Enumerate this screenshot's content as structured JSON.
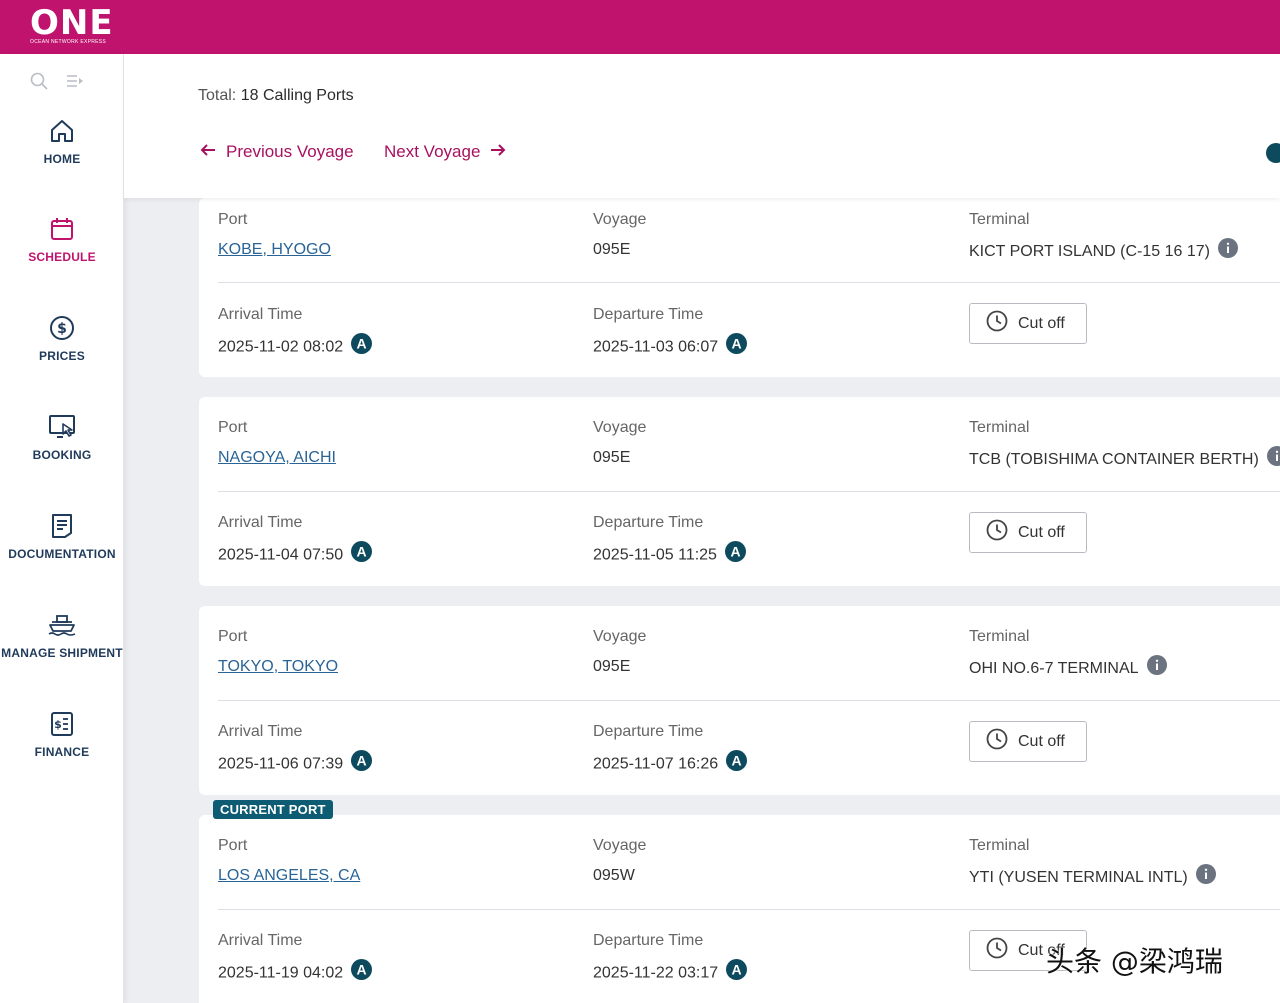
{
  "brand": {
    "name": "ONE",
    "tagline": "OCEAN NETWORK EXPRESS",
    "color": "#c0136e"
  },
  "sidebar": {
    "tools": {
      "search_icon": "search-icon",
      "collapse_icon": "collapse-menu-icon"
    },
    "items": [
      {
        "label": "HOME",
        "icon": "home-icon",
        "active": false
      },
      {
        "label": "SCHEDULE",
        "icon": "calendar-icon",
        "active": true
      },
      {
        "label": "PRICES",
        "icon": "dollar-icon",
        "active": false
      },
      {
        "label": "BOOKING",
        "icon": "booking-icon",
        "active": false
      },
      {
        "label": "DOCUMENTATION",
        "icon": "document-icon",
        "active": false
      },
      {
        "label": "MANAGE SHIPMENT",
        "icon": "ship-icon",
        "active": false
      },
      {
        "label": "FINANCE",
        "icon": "finance-icon",
        "active": false
      }
    ]
  },
  "header": {
    "total_label": "Total:",
    "total_value": "18 Calling Ports",
    "previous_voyage": "Previous Voyage",
    "next_voyage": "Next Voyage"
  },
  "labels": {
    "port": "Port",
    "voyage": "Voyage",
    "terminal": "Terminal",
    "arrival": "Arrival Time",
    "departure": "Departure Time",
    "cutoff": "Cut off",
    "current_port": "CURRENT PORT"
  },
  "ports": [
    {
      "port": "KOBE, HYOGO",
      "voyage": "095E",
      "terminal": "KICT PORT ISLAND (C-15 16 17)",
      "arrival": "2025-11-02 08:02",
      "departure": "2025-11-03 06:07",
      "current": false
    },
    {
      "port": "NAGOYA, AICHI",
      "voyage": "095E",
      "terminal": "TCB (TOBISHIMA CONTAINER BERTH)",
      "arrival": "2025-11-04 07:50",
      "departure": "2025-11-05 11:25",
      "current": false
    },
    {
      "port": "TOKYO, TOKYO",
      "voyage": "095E",
      "terminal": "OHI NO.6-7 TERMINAL",
      "arrival": "2025-11-06 07:39",
      "departure": "2025-11-07 16:26",
      "current": false
    },
    {
      "port": "LOS ANGELES, CA",
      "voyage": "095W",
      "terminal": "YTI (YUSEN TERMINAL INTL)",
      "arrival": "2025-11-19 04:02",
      "departure": "2025-11-22 03:17",
      "current": true
    }
  ],
  "badge_letter": "A",
  "watermark": "头条 @梁鸿瑞",
  "colors": {
    "accent": "#c0136e",
    "link": "#2a6496",
    "badge": "#0d4a5e",
    "nav_text": "#1f3a5a"
  }
}
